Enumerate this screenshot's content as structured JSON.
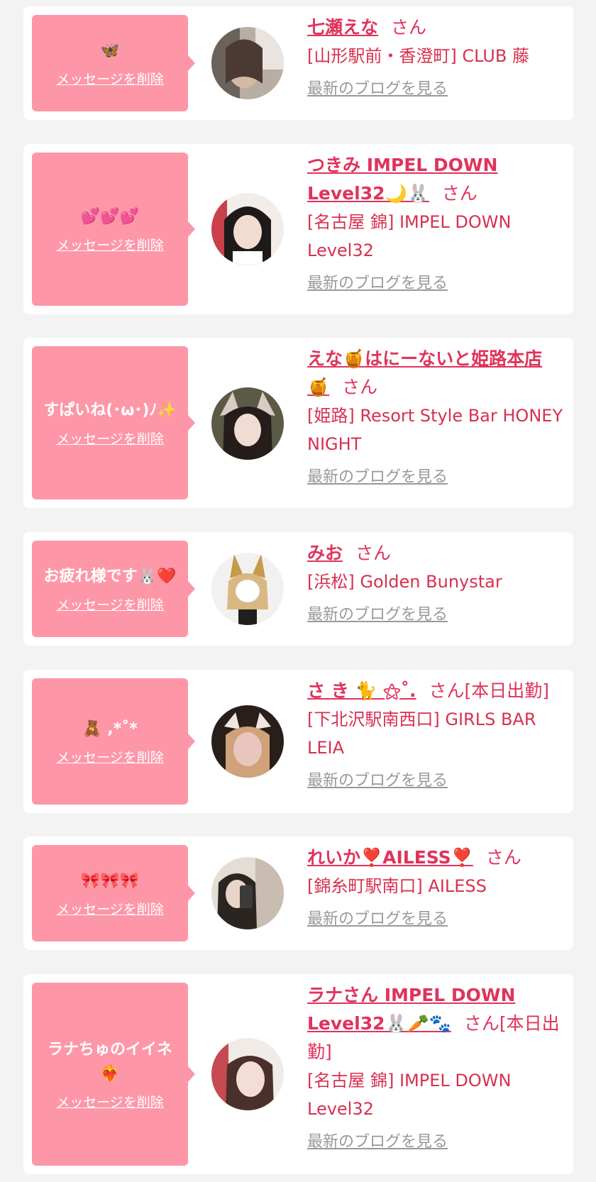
{
  "delete_label": "メッセージを削除",
  "blog_label": "最新のブログを見る",
  "san_suffix": "さん",
  "accent_color": "#e0335b",
  "bubble_color": "#fd97a8",
  "items": [
    {
      "message": "🦋",
      "name": "七瀬えな",
      "suffix": "さん",
      "shop": "[山形駅前・香澄町] CLUB 藤"
    },
    {
      "message": "💕💕💕",
      "name": "つきみ IMPEL DOWN Level32🌙🐰",
      "suffix": "さん",
      "shop": "[名古屋 錦] IMPEL DOWN Level32"
    },
    {
      "message": "すぱいね(･ω･)ﾉ✨",
      "name": "えな🍯はにーないと姫路本店🍯",
      "suffix": "さん",
      "shop": "[姫路] Resort Style Bar HONEY NIGHT"
    },
    {
      "message": "お疲れ様です🐰❤️",
      "name": "みお",
      "suffix": "さん",
      "shop": "[浜松] Golden Bunystar"
    },
    {
      "message": "🧸 ,*˚*",
      "name": "さ き 🐈 ⚝˚.",
      "suffix": "さん[本日出勤]",
      "shop": "[下北沢駅南西口] GIRLS BAR LEIA"
    },
    {
      "message": "🎀🎀🎀",
      "name": "れいか❣️AILESS❣️",
      "suffix": "さん",
      "shop": "[錦糸町駅南口] AILESS"
    },
    {
      "message": "ラナちゅのイイネ❤️‍🔥",
      "name": "ラナさん IMPEL DOWN Level32🐰🥕🐾",
      "suffix": "さん[本日出勤]",
      "shop": "[名古屋 錦] IMPEL DOWN Level32"
    }
  ]
}
